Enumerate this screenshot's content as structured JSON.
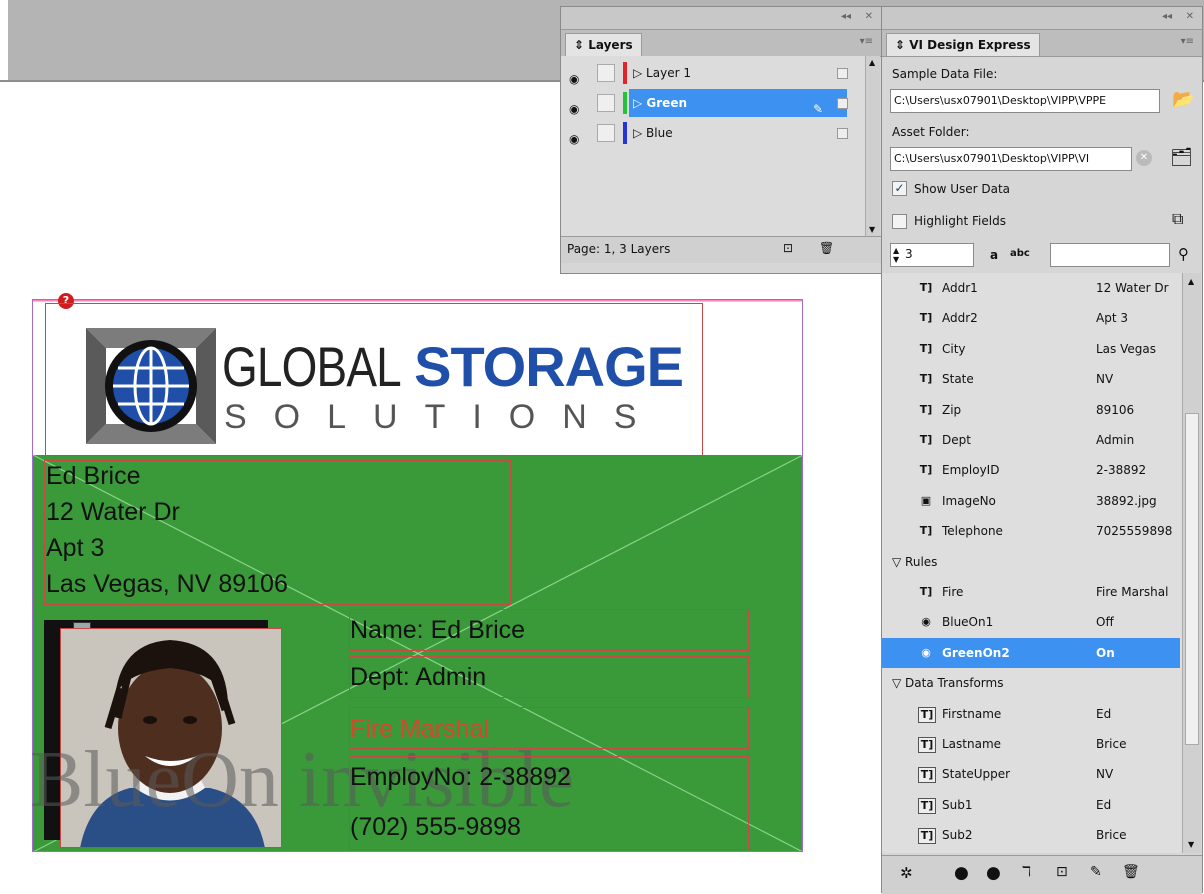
{
  "layers_panel": {
    "title": "Layers",
    "layers": [
      {
        "name": "Layer 1",
        "color": "#e0262a",
        "selected": false
      },
      {
        "name": "Green",
        "color": "#25c23a",
        "selected": true
      },
      {
        "name": "Blue",
        "color": "#2335d8",
        "selected": false
      }
    ],
    "footer_text": "Page: 1, 3 Layers"
  },
  "card": {
    "logo_word1": "GLOBAL",
    "logo_word2": "STORAGE",
    "logo_word3": "SOLUTIONS",
    "address_lines": [
      "Ed Brice",
      "12 Water Dr",
      "Apt 3",
      "Las Vegas, NV 89106"
    ],
    "name_line": "Name: Ed Brice",
    "dept_line": "Dept: Admin",
    "rule_line": "Fire Marshal",
    "employ_line": "EmployNo: 2-38892",
    "phone_line": "(702) 555-9898",
    "watermark": "BlueOn invisible",
    "green_color": "#3a9a3a",
    "logo_blue": "#1f4fa8"
  },
  "vi_panel": {
    "title": "VI Design Express",
    "sample_label": "Sample Data File:",
    "sample_path": "C:\\Users\\usx07901\\Desktop\\VIPP\\VPPE",
    "asset_label": "Asset Folder:",
    "asset_path": "C:\\Users\\usx07901\\Desktop\\VIPP\\VI",
    "show_user_data": "Show User Data",
    "highlight_fields": "Highlight Fields",
    "record_number": "3",
    "data_fields": [
      {
        "name": "Addr1",
        "value": "12 Water Dr",
        "icon": "text-field-icon"
      },
      {
        "name": "Addr2",
        "value": "Apt 3",
        "icon": "text-field-icon"
      },
      {
        "name": "City",
        "value": "Las Vegas",
        "icon": "text-field-icon"
      },
      {
        "name": "State",
        "value": "NV",
        "icon": "text-field-icon"
      },
      {
        "name": "Zip",
        "value": "89106",
        "icon": "text-field-icon"
      },
      {
        "name": "Dept",
        "value": "Admin",
        "icon": "text-field-icon"
      },
      {
        "name": "EmployID",
        "value": "2-38892",
        "icon": "text-field-icon"
      },
      {
        "name": "ImageNo",
        "value": "38892.jpg",
        "icon": "image-field-icon"
      },
      {
        "name": "Telephone",
        "value": "7025559898",
        "icon": "text-field-icon"
      }
    ],
    "rules_label": "Rules",
    "rules": [
      {
        "name": "Fire",
        "value": "Fire Marshal",
        "icon": "text-rule-icon",
        "selected": false
      },
      {
        "name": "BlueOn1",
        "value": "Off",
        "icon": "eye-rule-icon",
        "selected": false
      },
      {
        "name": "GreenOn2",
        "value": "On",
        "icon": "eye-rule-icon",
        "selected": true
      }
    ],
    "transforms_label": "Data Transforms",
    "transforms": [
      {
        "name": "Firstname",
        "value": "Ed"
      },
      {
        "name": "Lastname",
        "value": "Brice"
      },
      {
        "name": "StateUpper",
        "value": "NV"
      },
      {
        "name": "Sub1",
        "value": "Ed"
      },
      {
        "name": "Sub2",
        "value": "Brice"
      }
    ],
    "selection_color": "#3d91f0"
  }
}
